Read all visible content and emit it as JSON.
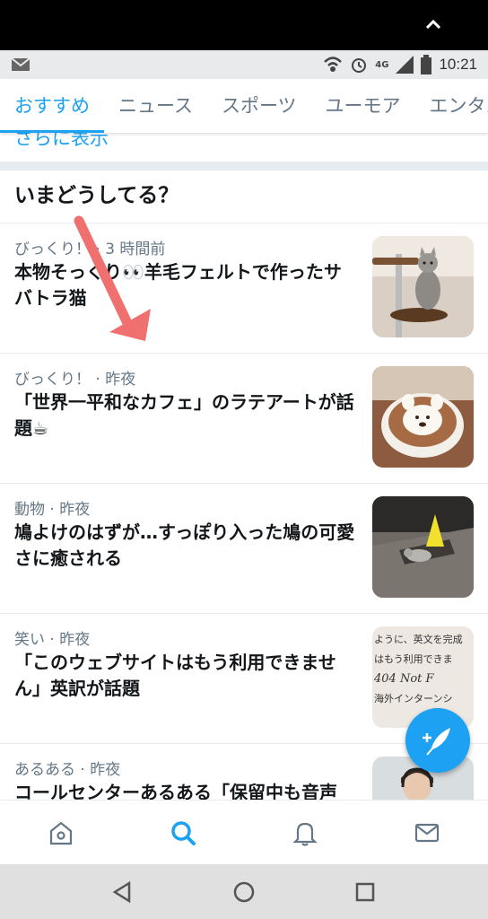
{
  "status": {
    "time": "10:21",
    "network": "4G"
  },
  "tabs": [
    "おすすめ",
    "ニュース",
    "スポーツ",
    "ユーモア",
    "エンタメ"
  ],
  "show_more": "さらに表示",
  "section_title": "いまどうしてる？",
  "items": [
    {
      "meta": "びっくり！ · 3 時間前",
      "headline": "本物そっくり👀羊毛フェルトで作ったサバトラ猫"
    },
    {
      "meta": "びっくり！ · 昨夜",
      "headline": "「世界一平和なカフェ」のラテアートが話題☕"
    },
    {
      "meta": "動物 · 昨夜",
      "headline": "鳩よけのはずが…すっぽり入った鳩の可愛さに癒される"
    },
    {
      "meta": "笑い · 昨夜",
      "headline": "「このウェブサイトはもう利用できません」英訳が話題"
    },
    {
      "meta": "あるある · 昨夜",
      "headline": "コールセンターあるある「保留中も音声"
    }
  ],
  "thumb4_text": [
    "ように、英文を完成",
    "はもう利用できま",
    "404 Not F",
    "海外インターンシ"
  ],
  "colors": {
    "accent": "#1da1f2",
    "arrow": "#f07070"
  },
  "icons": [
    "home-icon",
    "search-icon",
    "bell-icon",
    "mail-icon"
  ]
}
